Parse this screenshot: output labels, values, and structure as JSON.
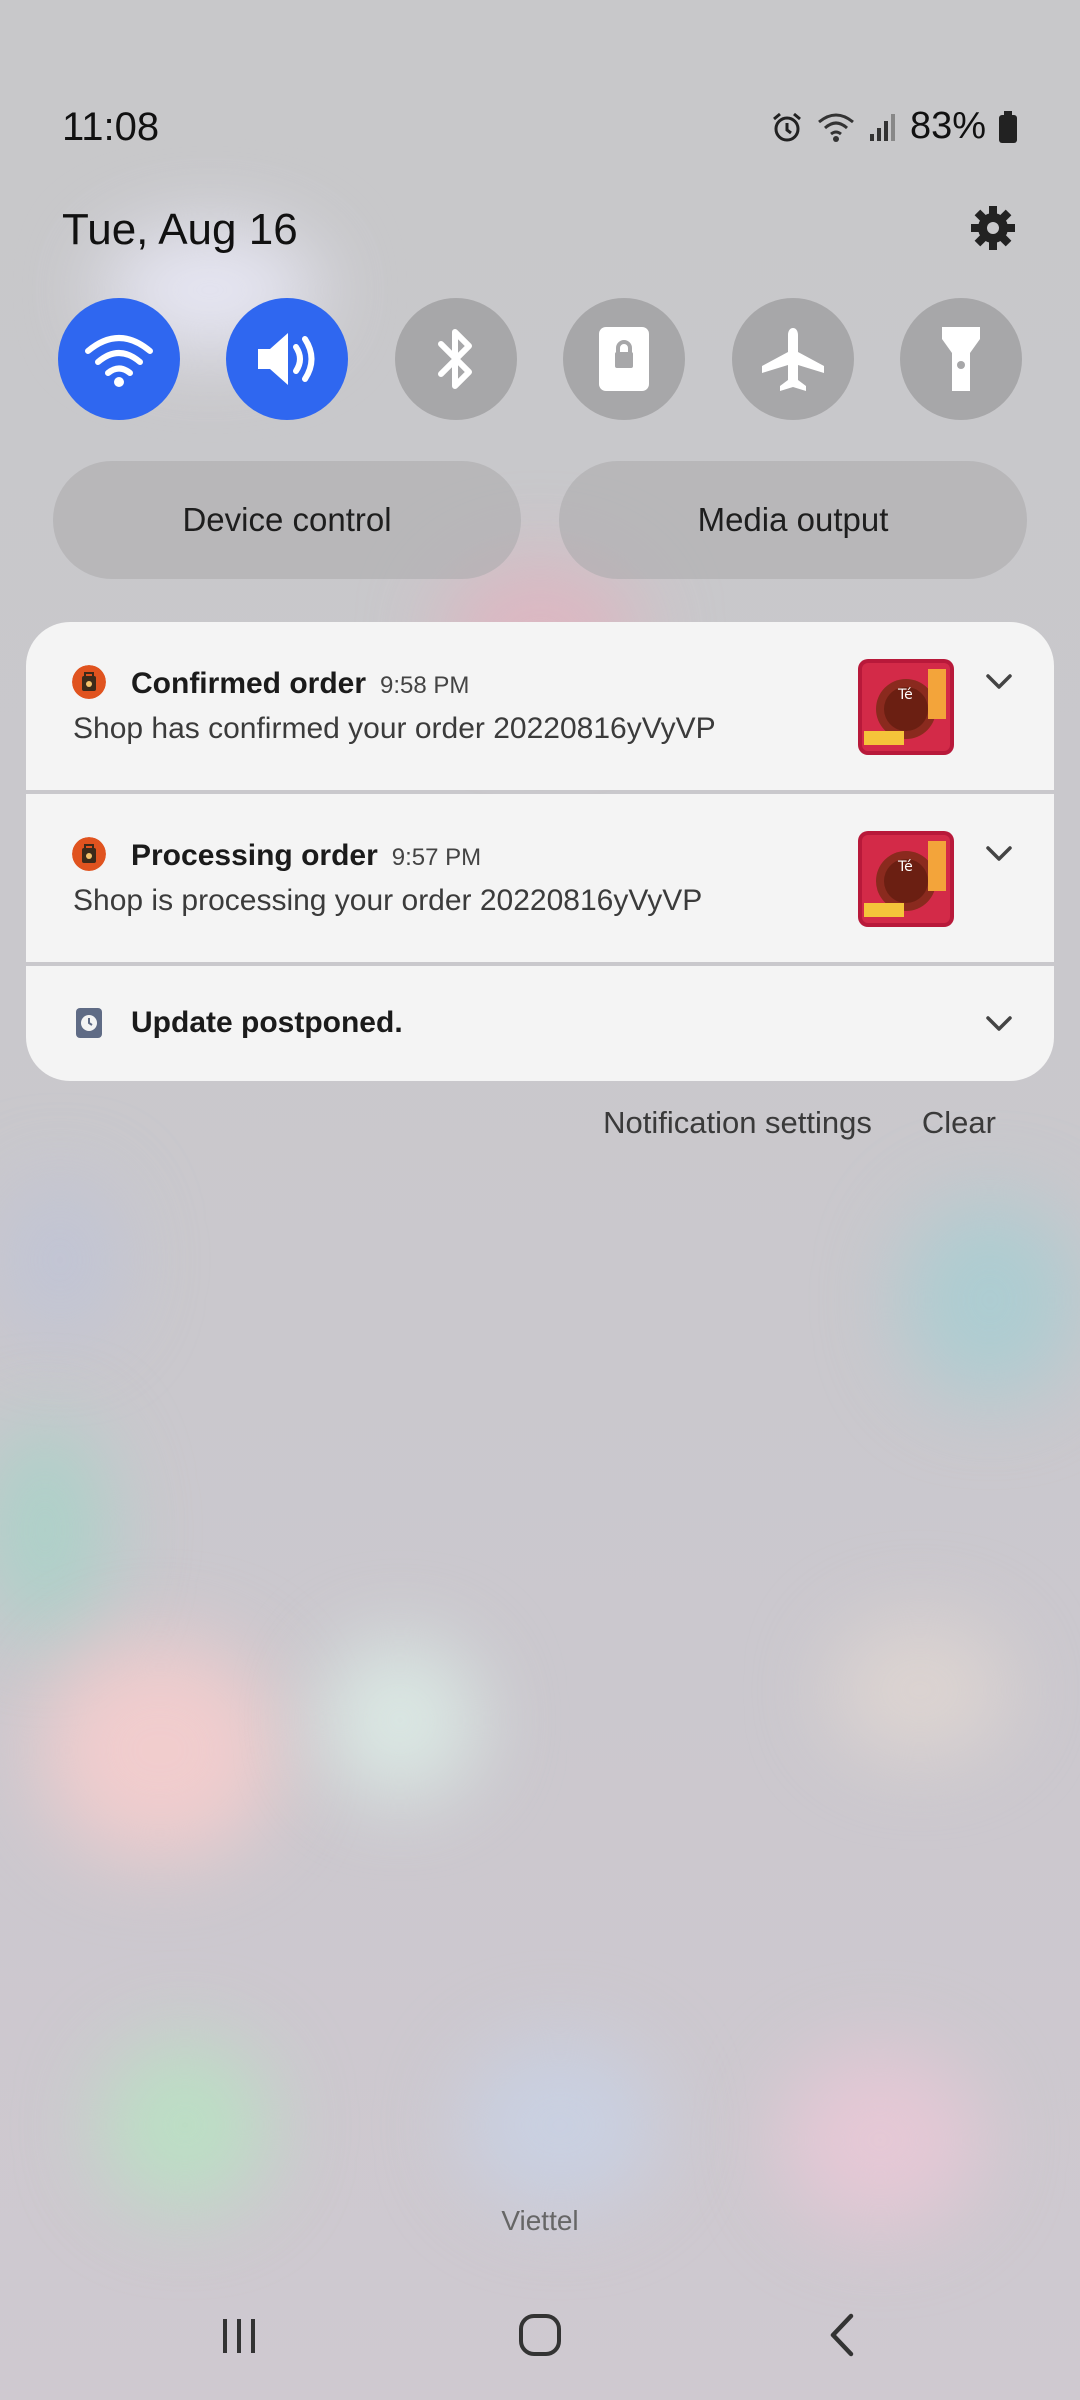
{
  "status_bar": {
    "time": "11:08",
    "battery": "83%",
    "icons": [
      "alarm-icon",
      "wifi-icon",
      "signal-icon",
      "battery-icon"
    ]
  },
  "header": {
    "date": "Tue, Aug 16",
    "settings_icon": "gear-icon"
  },
  "quick_tiles": [
    {
      "icon": "wifi-icon",
      "active": true
    },
    {
      "icon": "sound-icon",
      "active": true
    },
    {
      "icon": "bluetooth-icon",
      "active": false
    },
    {
      "icon": "rotation-lock-icon",
      "active": false
    },
    {
      "icon": "airplane-icon",
      "active": false
    },
    {
      "icon": "flashlight-icon",
      "active": false
    }
  ],
  "pills": {
    "device_control": "Device control",
    "media_output": "Media output"
  },
  "notifications": [
    {
      "title": "Confirmed order",
      "time": "9:58 PM",
      "body": "Shop has confirmed your order 20220816yVyVP"
    },
    {
      "title": "Processing order",
      "time": "9:57 PM",
      "body": "Shop is processing your order 20220816yVyVP"
    },
    {
      "title": "Update postponed."
    }
  ],
  "actions": {
    "settings": "Notification settings",
    "clear": "Clear"
  },
  "carrier": "Viettel",
  "nav": [
    "recents-icon",
    "home-icon",
    "back-icon"
  ],
  "colors": {
    "accent": "#2f67f0",
    "tile_off": "#a7a7a9",
    "card_bg": "#f4f4f4"
  }
}
